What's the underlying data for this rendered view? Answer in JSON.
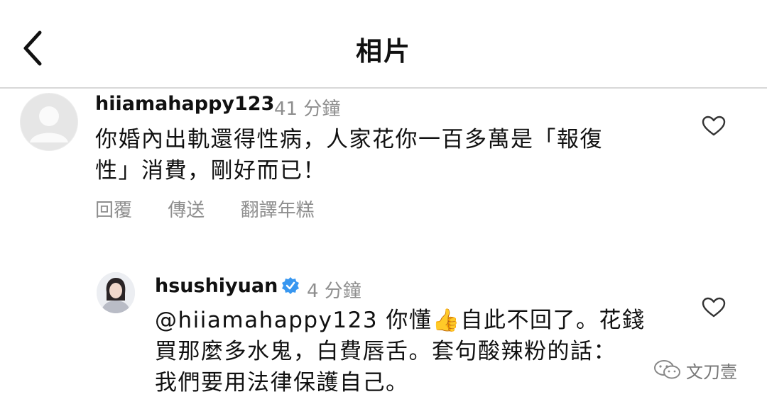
{
  "header": {
    "title": "相片"
  },
  "comments": [
    {
      "username": "hiiamahappy123",
      "time": "41 分鐘",
      "lines": [
        "你婚內出軌還得性病，人家花你一百多萬是「報復",
        "性」消費，剛好而已！"
      ],
      "actions": [
        "回覆",
        "傳送",
        "翻譯年糕"
      ]
    },
    {
      "username": "hsushiyuan",
      "time": "4 分鐘",
      "verified": true,
      "line1_before": "@hiiamahappy123 你懂",
      "emoji": "👍",
      "line1_after": "自此不回了。花錢",
      "line2": "買那麼多水鬼，白費唇舌。套句酸辣粉的話：",
      "line3": "我們要用法律保護自己。"
    }
  ],
  "watermark": {
    "text": "文刀壹"
  }
}
